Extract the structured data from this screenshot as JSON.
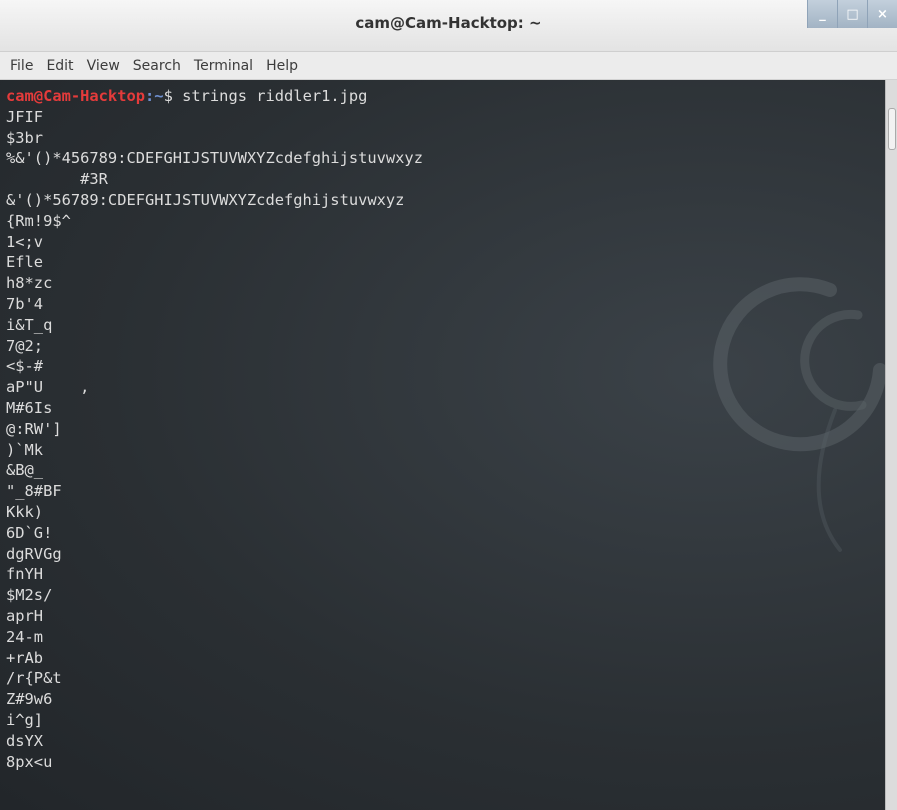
{
  "window": {
    "title": "cam@Cam-Hacktop: ~",
    "buttons": [
      "_",
      "□",
      "×"
    ]
  },
  "menu": [
    "File",
    "Edit",
    "View",
    "Search",
    "Terminal",
    "Help"
  ],
  "prompt": {
    "user": "cam@Cam-Hacktop",
    "sep": ":",
    "path": "~",
    "symbol": "$ ",
    "command": "strings riddler1.jpg"
  },
  "output_lines": [
    "JFIF",
    "$3br",
    "%&'()*456789:CDEFGHIJSTUVWXYZcdefghijstuvwxyz",
    "        #3R",
    "&'()*56789:CDEFGHIJSTUVWXYZcdefghijstuvwxyz",
    "{Rm!9$^",
    "1<;v",
    "Efle",
    "h8*zc",
    "7b'4",
    "i&T_q",
    "7@2;",
    "<$-#",
    "aP\"U    ,",
    "M#6Is",
    "@:RW']",
    ")`Mk",
    "&B@_",
    "\"_8#BF",
    "Kkk)",
    "6D`G!",
    "dgRVGg",
    "fnYH",
    "$M2s/",
    "aprH",
    "24-m",
    "+rAb",
    "/r{P&t",
    "Z#9w6",
    "i^g]",
    "dsYX",
    "8px<u"
  ]
}
